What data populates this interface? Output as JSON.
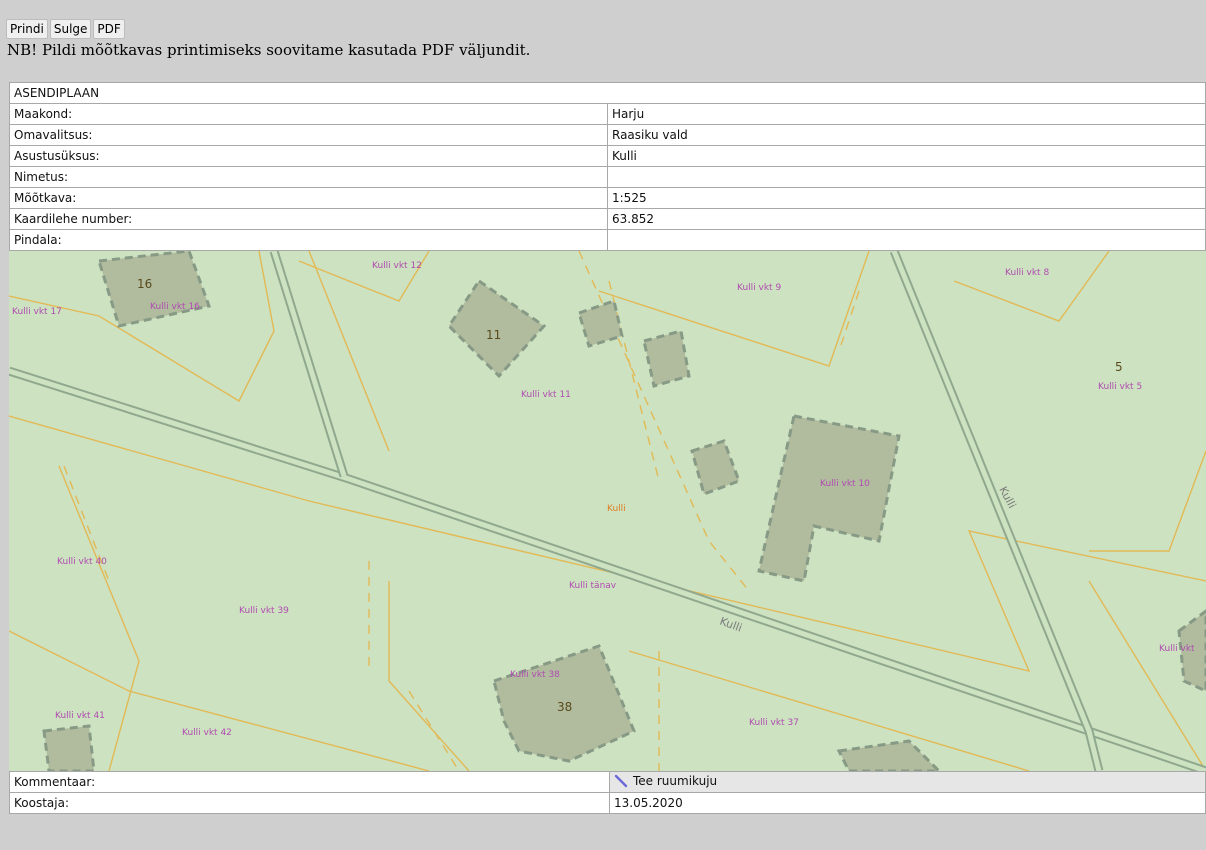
{
  "toolbar": {
    "print": "Prindi",
    "close": "Sulge",
    "pdf": "PDF"
  },
  "notice": "NB! Pildi mõõtkavas printimiseks soovitame kasutada PDF väljundit.",
  "sheet": {
    "title": "ASENDIPLAAN",
    "rows": [
      {
        "label": "Maakond:",
        "value": "Harju"
      },
      {
        "label": "Omavalitsus:",
        "value": "Raasiku vald"
      },
      {
        "label": "Asustusüksus:",
        "value": "Kulli"
      },
      {
        "label": "Nimetus:",
        "value": ""
      },
      {
        "label": "Mõõtkava:",
        "value": "1:525"
      },
      {
        "label": "Kaardilehe number:",
        "value": "63.852"
      },
      {
        "label": "Pindala:",
        "value": ""
      }
    ],
    "comment_label": "Kommentaar:",
    "draw_button": "Tee ruumikuju",
    "author_label": "Koostaja:",
    "date": "13.05.2020"
  },
  "map": {
    "colors": {
      "land": "#cde2c1",
      "building": "#b1bc9f",
      "boundary": "#e2b955",
      "road": "#8fa88e",
      "label": "#b04cb0",
      "settlement": "#e07d22"
    },
    "labels": {
      "vkt12": "Kulli vkt 12",
      "vkt16": "Kulli vkt 16",
      "vkt17": "Kulli vkt 17",
      "vkt9": "Kulli vkt 9",
      "vkt8": "Kulli vkt 8",
      "vkt11": "Kulli vkt 11",
      "vkt5": "Kulli vkt 5",
      "vkt10": "Kulli vkt 10",
      "settlement": "Kulli",
      "vkt40": "Kulli vkt 40",
      "tanav": "Kulli tänav",
      "vkt39": "Kulli vkt 39",
      "road_main": "Kulli",
      "road_side": "Kulli",
      "vkt_right": "Kulli vkt",
      "vkt38": "Kulli vkt 38",
      "vkt41": "Kulli vkt 41",
      "vkt42": "Kulli vkt 42",
      "vkt37": "Kulli vkt 37"
    },
    "house_numbers": {
      "h16": "16",
      "h11": "11",
      "h5": "5",
      "h38": "38"
    }
  }
}
